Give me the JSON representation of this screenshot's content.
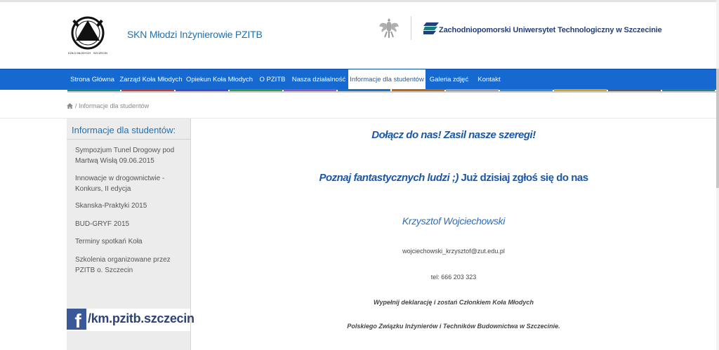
{
  "header": {
    "site_name": "SKN Młodzi Inżynierowie PZITB",
    "logo_caption": "KOŁO MŁODYCH · SZCZECIN",
    "university": "Zachodniopomorski Uniwersytet Technologiczny w Szczecinie"
  },
  "nav": {
    "items": [
      {
        "label": "Strona Główna"
      },
      {
        "label": "Zarząd Koła Młodych"
      },
      {
        "label": "Opiekun Koła Młodych"
      },
      {
        "label": "O PZITB"
      },
      {
        "label": "Nasza działalność"
      },
      {
        "label": "Informacje dla studentów"
      },
      {
        "label": "Galeria zdjęć"
      },
      {
        "label": "Kontakt"
      }
    ],
    "active_index": 5,
    "bar_color": "#1569d0"
  },
  "stripe_colors": [
    "#1a8a7a",
    "#c33b2e",
    "#4a4ab0",
    "#2f9b43",
    "#8a5bb5",
    "#1c72b8",
    "#b56a1a",
    "#9a9a9a",
    "#3a87c7",
    "#d4a017",
    "#5c5c5c",
    "#2f7f7f"
  ],
  "breadcrumb": {
    "current": "Informacje dla studentów"
  },
  "sidebar": {
    "title": "Informacje dla studentów:",
    "items": [
      {
        "label": "Sympozjum Tunel Drogowy pod Martwą Wisłą 09.06.2015"
      },
      {
        "label": "Innowacje w drogownictwie - Konkurs, II edycja"
      },
      {
        "label": "Skanska-Praktyki 2015"
      },
      {
        "label": "BUD-GRYF 2015"
      },
      {
        "label": "Terminy spotkań Koła"
      },
      {
        "label": "Szkolenia organizowane przez PZITB o. Szczecin"
      }
    ],
    "facebook": {
      "icon_letter": "f",
      "text": "/km.pzitb.szczecin"
    }
  },
  "content": {
    "heading1": "Dołącz do nas! Zasil nasze szeregi!",
    "heading2_italic": "Poznaj fantastycznych ludzi ;)",
    "heading2_rest": " Już dzisiaj zgłoś się do nas",
    "contact_name": "Krzysztof Wojciechowski",
    "email": "wojciechowski_krzysztof@zut.edu.pl",
    "phone": "tel: 666 203 323",
    "note1": "Wypełnij deklarację i zostań Członkiem Koła Młodych",
    "note2": "Polskiego Związku Inżynierów i Techników Budownictwa w Szczecinie."
  }
}
